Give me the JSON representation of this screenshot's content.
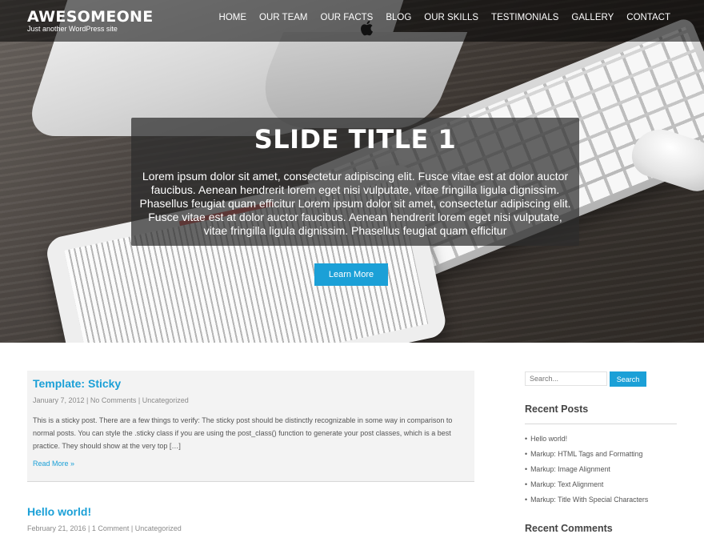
{
  "site": {
    "title": "AWESOMEONE",
    "tagline": "Just another WordPress site"
  },
  "nav": {
    "items": [
      "HOME",
      "OUR TEAM",
      "OUR FACTS",
      "BLOG",
      "OUR SKILLS",
      "TESTIMONIALS",
      "GALLERY",
      "CONTACT"
    ]
  },
  "slider": {
    "title": "SLIDE TITLE 1",
    "text": "Lorem ipsum dolor sit amet, consectetur adipiscing elit. Fusce vitae est at dolor auctor faucibus. Aenean hendrerit lorem eget nisi vulputate, vitae fringilla ligula dignissim. Phasellus feugiat quam efficitur Lorem ipsum dolor sit amet, consectetur adipiscing elit. Fusce vitae est at dolor auctor faucibus. Aenean hendrerit lorem eget nisi vulputate, vitae fringilla ligula dignissim. Phasellus feugiat quam efficitur",
    "button_label": "Learn More"
  },
  "posts": [
    {
      "title": "Template: Sticky",
      "meta": "January 7, 2012 | No Comments | Uncategorized",
      "excerpt": "This is a sticky post. There are a few things to verify: The sticky post should be distinctly recognizable in some way in comparison to normal posts. You can style the .sticky class if you are using the post_class() function to generate your post classes, which is a best practice. They should show at the very top […]",
      "read_more": "Read More »"
    },
    {
      "title": "Hello world!",
      "meta": "February 21, 2016 | 1 Comment | Uncategorized"
    }
  ],
  "sidebar": {
    "search": {
      "placeholder": "Search...",
      "button_label": "Search"
    },
    "recent_posts": {
      "title": "Recent Posts",
      "items": [
        "Hello world!",
        "Markup: HTML Tags and Formatting",
        "Markup: Image Alignment",
        "Markup: Text Alignment",
        "Markup: Title With Special Characters"
      ]
    },
    "recent_comments": {
      "title": "Recent Comments"
    }
  },
  "colors": {
    "accent": "#1ba0d7",
    "header_bg": "#000000"
  }
}
